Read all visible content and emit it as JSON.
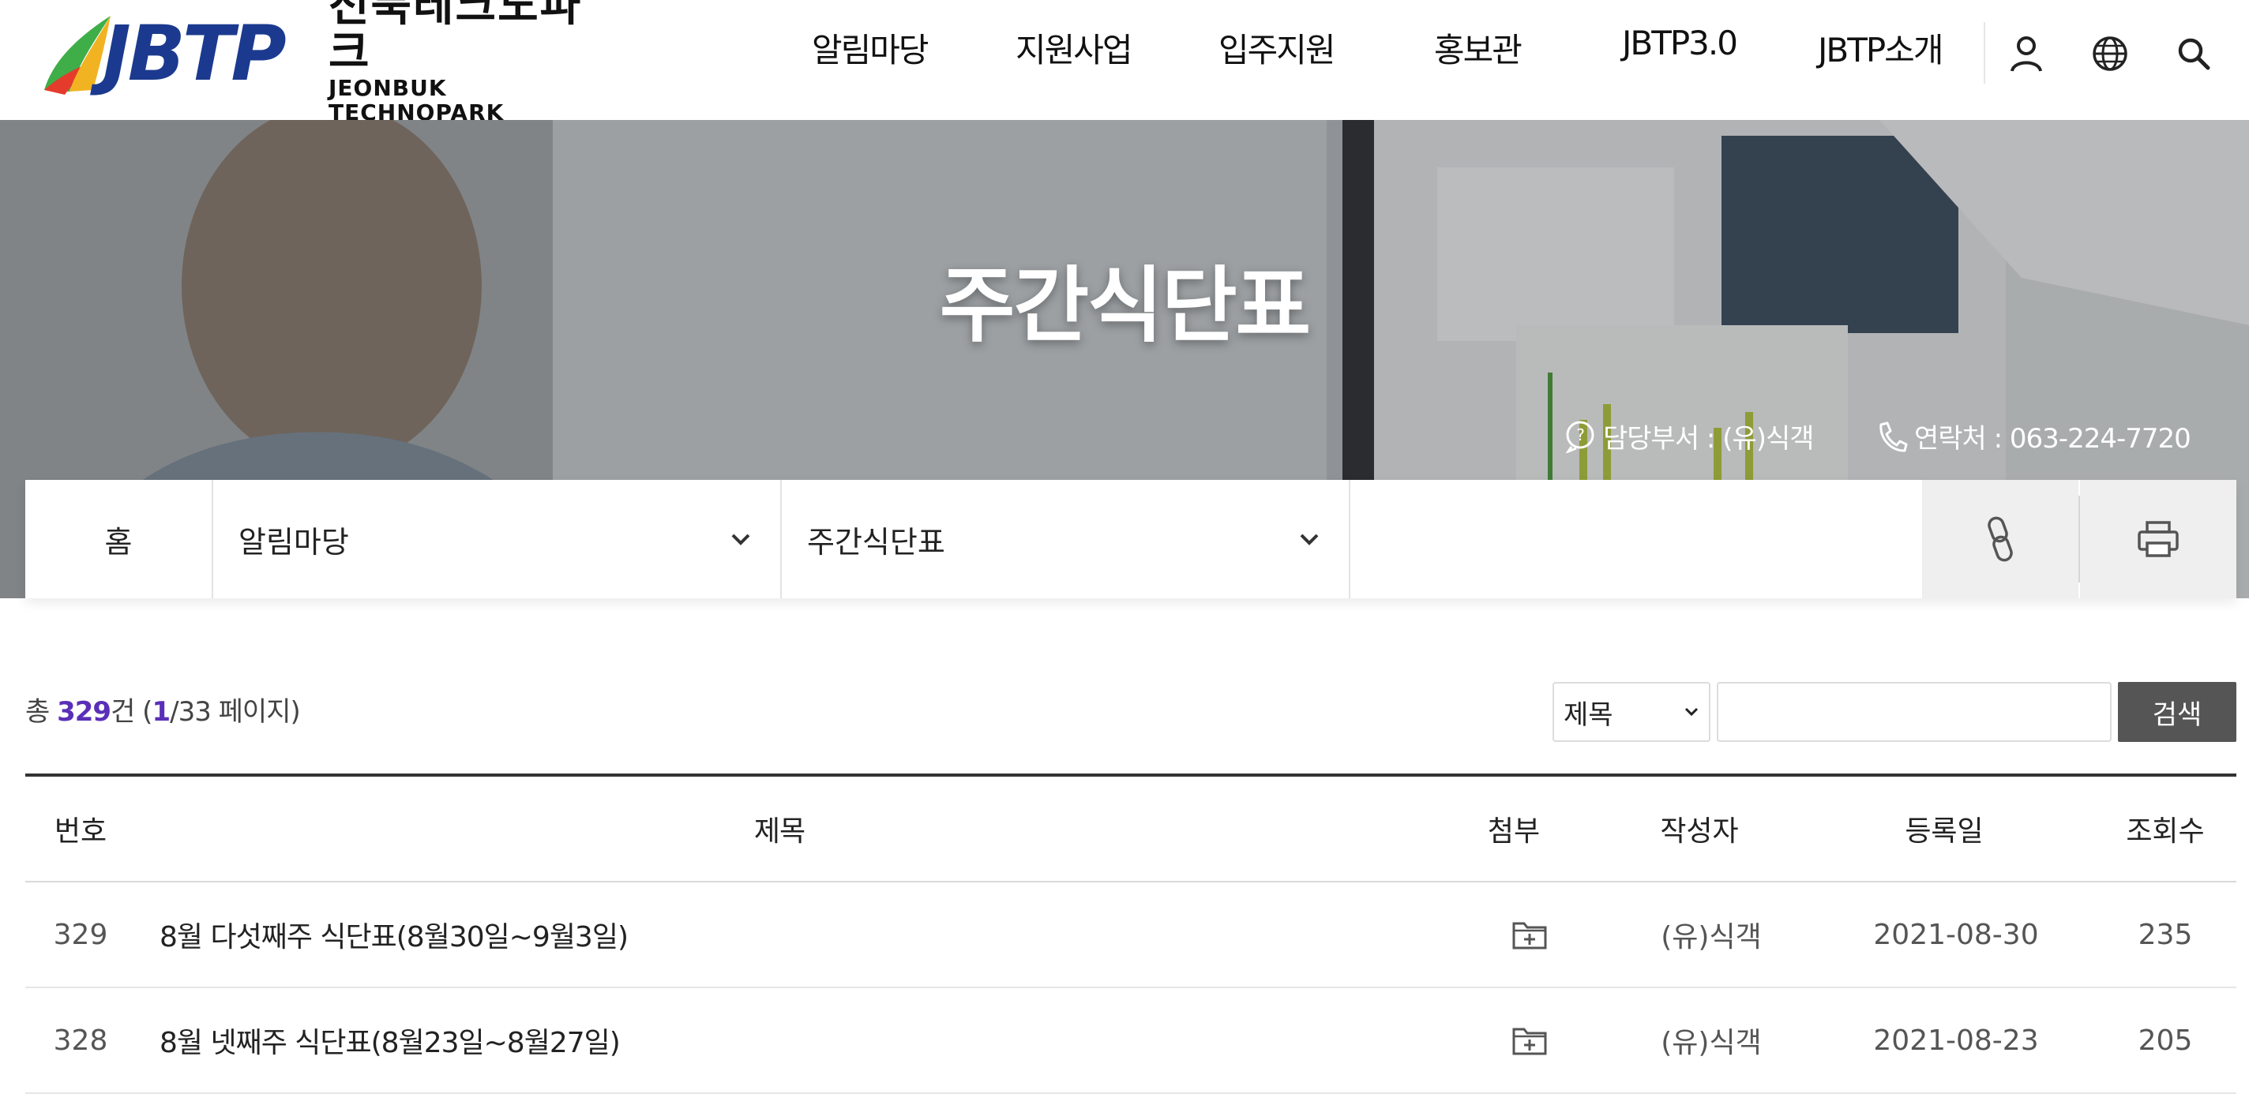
{
  "header": {
    "logo_mark": "JBTP",
    "logo_kr": "전북테크노파크",
    "logo_en": "JEONBUK TECHNOPARK",
    "nav": [
      "알림마당",
      "지원사업",
      "입주지원",
      "홍보관",
      "JBTP3.0",
      "JBTP소개"
    ],
    "icons": [
      "user-icon",
      "globe-icon",
      "search-icon"
    ]
  },
  "hero": {
    "title": "주간식단표",
    "dept_label": "담당부서 : (유)식객",
    "contact_label": "연락처 : 063-224-7720"
  },
  "location": {
    "home": "홈",
    "level1": "알림마당",
    "level2": "주간식단표",
    "icons": [
      "link-icon",
      "print-icon"
    ]
  },
  "board": {
    "total_prefix": "총 ",
    "total_count": "329",
    "total_unit": "건 (",
    "current_page": "1",
    "page_suffix": "/33 페이지)",
    "search_field": "제목",
    "search_value": "",
    "search_button": "검색",
    "columns": [
      "번호",
      "제목",
      "첨부",
      "작성자",
      "등록일",
      "조회수"
    ],
    "rows": [
      {
        "num": "329",
        "title": "8월 다섯째주 식단표(8월30일~9월3일)",
        "writer": "(유)식객",
        "date": "2021-08-30",
        "views": "235"
      },
      {
        "num": "328",
        "title": "8월 넷째주 식단표(8월23일~8월27일)",
        "writer": "(유)식객",
        "date": "2021-08-23",
        "views": "205"
      }
    ]
  },
  "colors": {
    "brand_blue": "#1b3a8f",
    "accent_purple": "#5a2fb8",
    "search_button_bg": "#555555"
  }
}
